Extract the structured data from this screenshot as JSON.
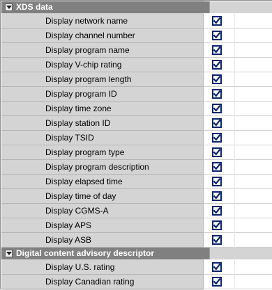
{
  "sections": [
    {
      "title": "XDS data",
      "items": [
        {
          "label": "Display network name",
          "checked": true
        },
        {
          "label": "Display channel number",
          "checked": true
        },
        {
          "label": "Display program name",
          "checked": true
        },
        {
          "label": "Display V-chip rating",
          "checked": true
        },
        {
          "label": "Display program length",
          "checked": true
        },
        {
          "label": "Display program ID",
          "checked": true
        },
        {
          "label": "Display time zone",
          "checked": true
        },
        {
          "label": "Display station ID",
          "checked": true
        },
        {
          "label": "Display TSID",
          "checked": true
        },
        {
          "label": "Display program type",
          "checked": true
        },
        {
          "label": "Display program description",
          "checked": true
        },
        {
          "label": "Display elapsed time",
          "checked": true
        },
        {
          "label": "Display time of day",
          "checked": true
        },
        {
          "label": "Display CGMS-A",
          "checked": true
        },
        {
          "label": "Display APS",
          "checked": true
        },
        {
          "label": "Display ASB",
          "checked": true
        }
      ]
    },
    {
      "title": "Digital content advisory descriptor",
      "items": [
        {
          "label": "Display U.S. rating",
          "checked": true
        },
        {
          "label": "Display Canadian rating",
          "checked": true
        }
      ]
    }
  ],
  "icons": {
    "section_toggle": "collapse-triangle-icon",
    "checkbox": "checkmark-icon"
  },
  "colors": {
    "header_bg": "#808080",
    "row_bg": "#d4d4d4",
    "checkbox_border": "#0a246a"
  }
}
